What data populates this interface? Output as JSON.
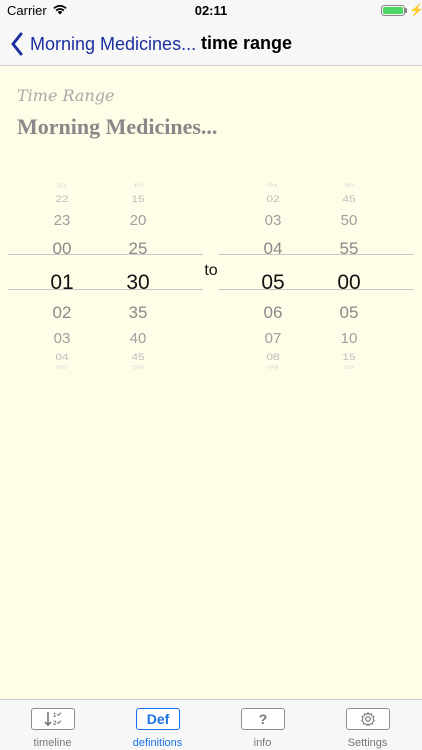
{
  "status_bar": {
    "carrier": "Carrier",
    "time": "02:11",
    "battery_level": 1.0,
    "battery_color": "#4cd964"
  },
  "nav": {
    "back_label": "Morning Medicines...",
    "title": "time range",
    "back_icon": "chevron-left-icon",
    "accent_color": "#1c2f9e"
  },
  "content": {
    "section_label": "Time Range",
    "definition_name": "Morning Medicines...",
    "background_color": "#fffde7"
  },
  "picker": {
    "to_label": "to",
    "start_hours": [
      "21",
      "22",
      "23",
      "00",
      "01",
      "02",
      "03",
      "04",
      "05"
    ],
    "start_minutes": [
      "10",
      "15",
      "20",
      "25",
      "30",
      "35",
      "40",
      "45",
      "50"
    ],
    "end_hours": [
      "01",
      "02",
      "03",
      "04",
      "05",
      "06",
      "07",
      "08",
      "09"
    ],
    "end_minutes": [
      "40",
      "45",
      "50",
      "55",
      "00",
      "05",
      "10",
      "15",
      "20"
    ],
    "selected": {
      "start_hour": "01",
      "start_minute": "30",
      "end_hour": "05",
      "end_minute": "00"
    }
  },
  "tabs": [
    {
      "label": "timeline",
      "icon": "timeline-sort-icon",
      "icon_text": "",
      "active": false
    },
    {
      "label": "definitions",
      "icon": "definitions-icon",
      "icon_text": "Def",
      "active": true
    },
    {
      "label": "info",
      "icon": "question-mark-icon",
      "icon_text": "?",
      "active": false
    },
    {
      "label": "Settings",
      "icon": "gear-icon",
      "icon_text": "",
      "active": false
    }
  ],
  "tab_active_color": "#1a73e8"
}
